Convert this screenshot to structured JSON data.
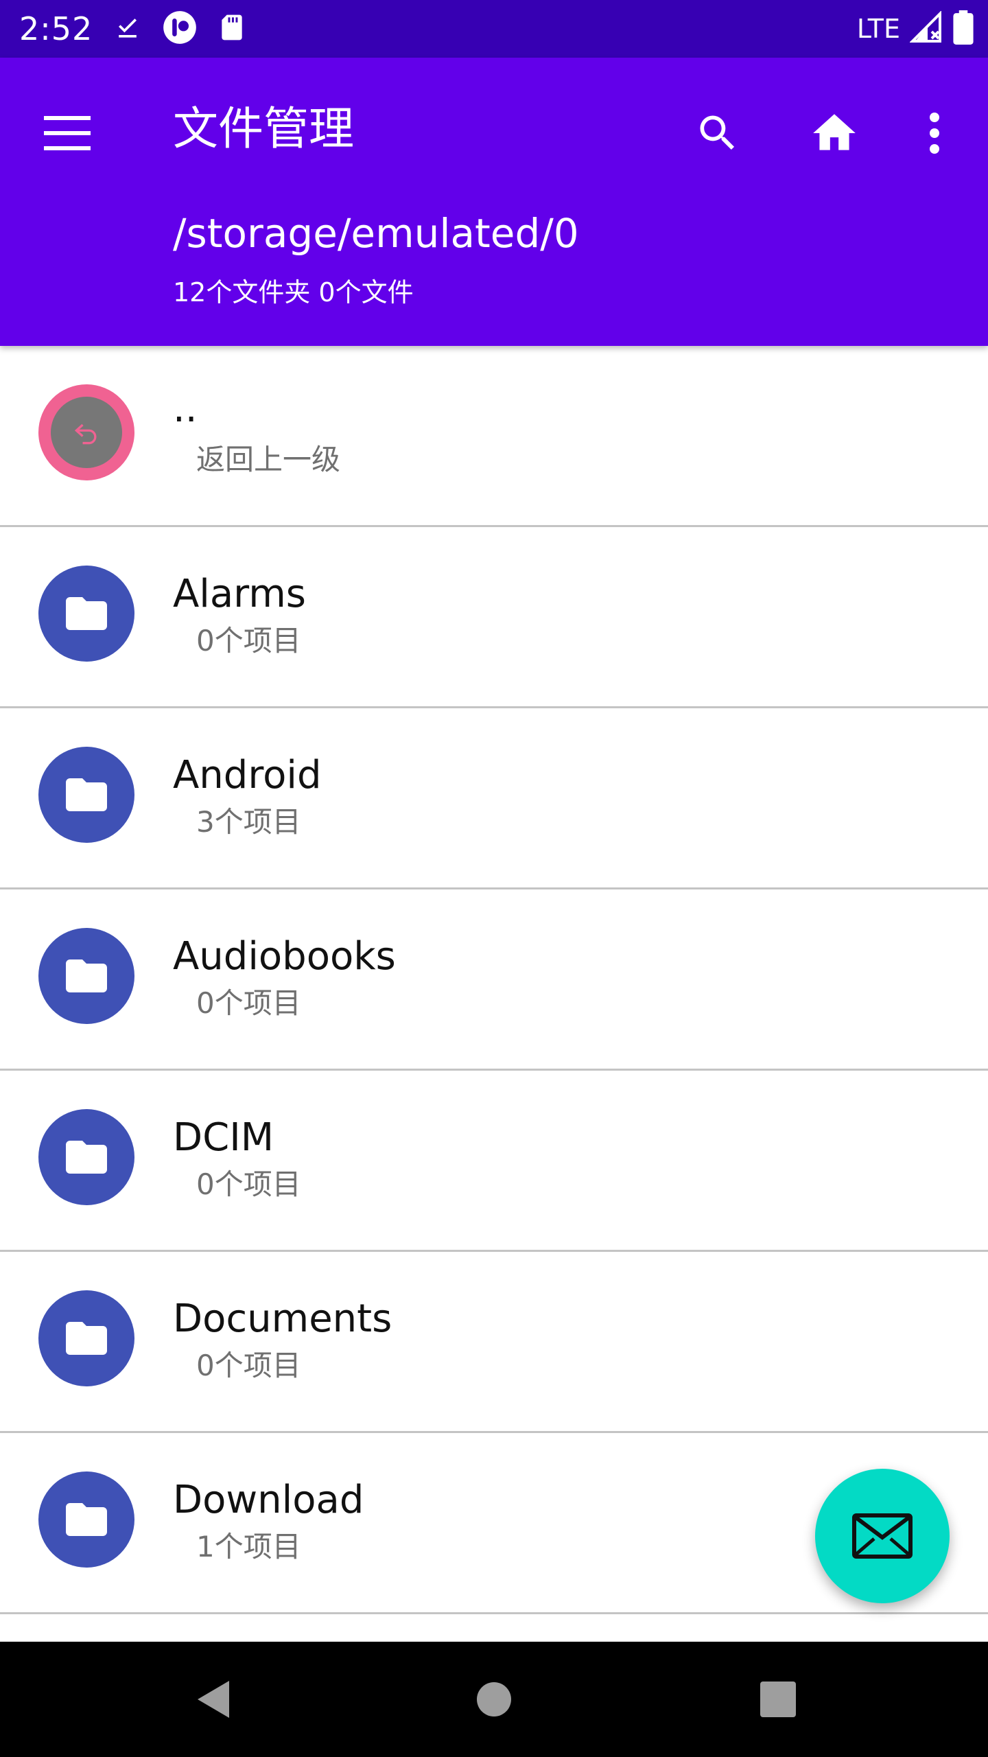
{
  "status_bar": {
    "time": "2:52",
    "network": "LTE",
    "icons": [
      "download-done-icon",
      "app-notification-icon",
      "sd-card-icon",
      "signal-icon",
      "battery-icon"
    ]
  },
  "app_bar": {
    "title": "文件管理",
    "path": "/storage/emulated/0",
    "summary": "12个文件夹 0个文件",
    "icons": [
      "menu-icon",
      "search-icon",
      "home-icon",
      "more-vert-icon"
    ]
  },
  "colors": {
    "status_bar": "#3700b3",
    "app_bar": "#6200ea",
    "folder_avatar": "#3f51b5",
    "back_avatar": "#f06292",
    "fab": "#03dac5",
    "nav_bar": "#000000"
  },
  "list": {
    "back_item": {
      "name": "..",
      "meta": "返回上一级",
      "icon": "back-arrow-icon"
    },
    "folders": [
      {
        "name": "Alarms",
        "meta": "0个项目",
        "icon": "folder-icon"
      },
      {
        "name": "Android",
        "meta": "3个项目",
        "icon": "folder-icon"
      },
      {
        "name": "Audiobooks",
        "meta": "0个项目",
        "icon": "folder-icon"
      },
      {
        "name": "DCIM",
        "meta": "0个项目",
        "icon": "folder-icon"
      },
      {
        "name": "Documents",
        "meta": "0个项目",
        "icon": "folder-icon"
      },
      {
        "name": "Download",
        "meta": "1个项目",
        "icon": "folder-icon"
      }
    ]
  },
  "fab": {
    "icon": "mail-icon"
  },
  "nav_bar": {
    "icons": [
      "back-triangle-icon",
      "home-circle-icon",
      "recents-square-icon"
    ]
  }
}
